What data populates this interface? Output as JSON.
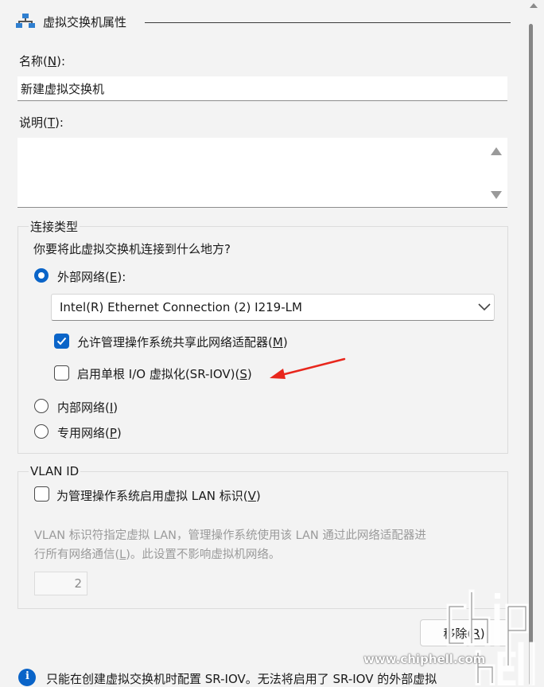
{
  "header": {
    "title": "虚拟交换机属性",
    "icon": "network-switch-icon"
  },
  "name": {
    "label_prefix": "名称(",
    "label_key": "N",
    "label_suffix": "):",
    "value": "新建虚拟交换机"
  },
  "description": {
    "label_prefix": "说明(",
    "label_key": "T",
    "label_suffix": "):",
    "value": ""
  },
  "connection_type": {
    "title": "连接类型",
    "question": "你要将此虚拟交换机连接到什么地方?",
    "external": {
      "label_prefix": "外部网络(",
      "label_key": "E",
      "label_suffix": "):",
      "selected": true
    },
    "adapter": {
      "value": "Intel(R) Ethernet Connection (2) I219-LM"
    },
    "allow_mgmt": {
      "label_prefix": "允许管理操作系统共享此网络适配器(",
      "label_key": "M",
      "label_suffix": ")",
      "checked": true
    },
    "sriov": {
      "label_prefix": "启用单根 I/O 虚拟化(SR-IOV)(",
      "label_key": "S",
      "label_suffix": ")",
      "checked": false
    },
    "internal": {
      "label_prefix": "内部网络(",
      "label_key": "I",
      "label_suffix": ")",
      "selected": false
    },
    "private": {
      "label_prefix": "专用网络(",
      "label_key": "P",
      "label_suffix": ")",
      "selected": false
    }
  },
  "vlan": {
    "title": "VLAN ID",
    "enable": {
      "label_prefix": "为管理操作系统启用虚拟 LAN 标识(",
      "label_key": "V",
      "label_suffix": ")",
      "checked": false
    },
    "desc_line1": "VLAN 标识符指定虚拟 LAN，管理操作系统使用该 LAN 通过此网络适配器进",
    "desc_line2_prefix": "行所有网络通信(",
    "desc_line2_key": "L",
    "desc_line2_suffix": ")。此设置不影响虚拟机网络。",
    "value": "2"
  },
  "remove_button": {
    "label_prefix": "移除(",
    "label_key": "R",
    "label_suffix": ")"
  },
  "info": {
    "text": "只能在创建虚拟交换机时配置 SR-IOV。无法将启用了 SR-IOV 的外部虚拟"
  },
  "watermark": {
    "logo_text": "chip hell",
    "url": "www.chiphell.com"
  },
  "colors": {
    "accent": "#0a64c8",
    "background": "#f3f3f3",
    "annotation_arrow": "#e8261c"
  }
}
